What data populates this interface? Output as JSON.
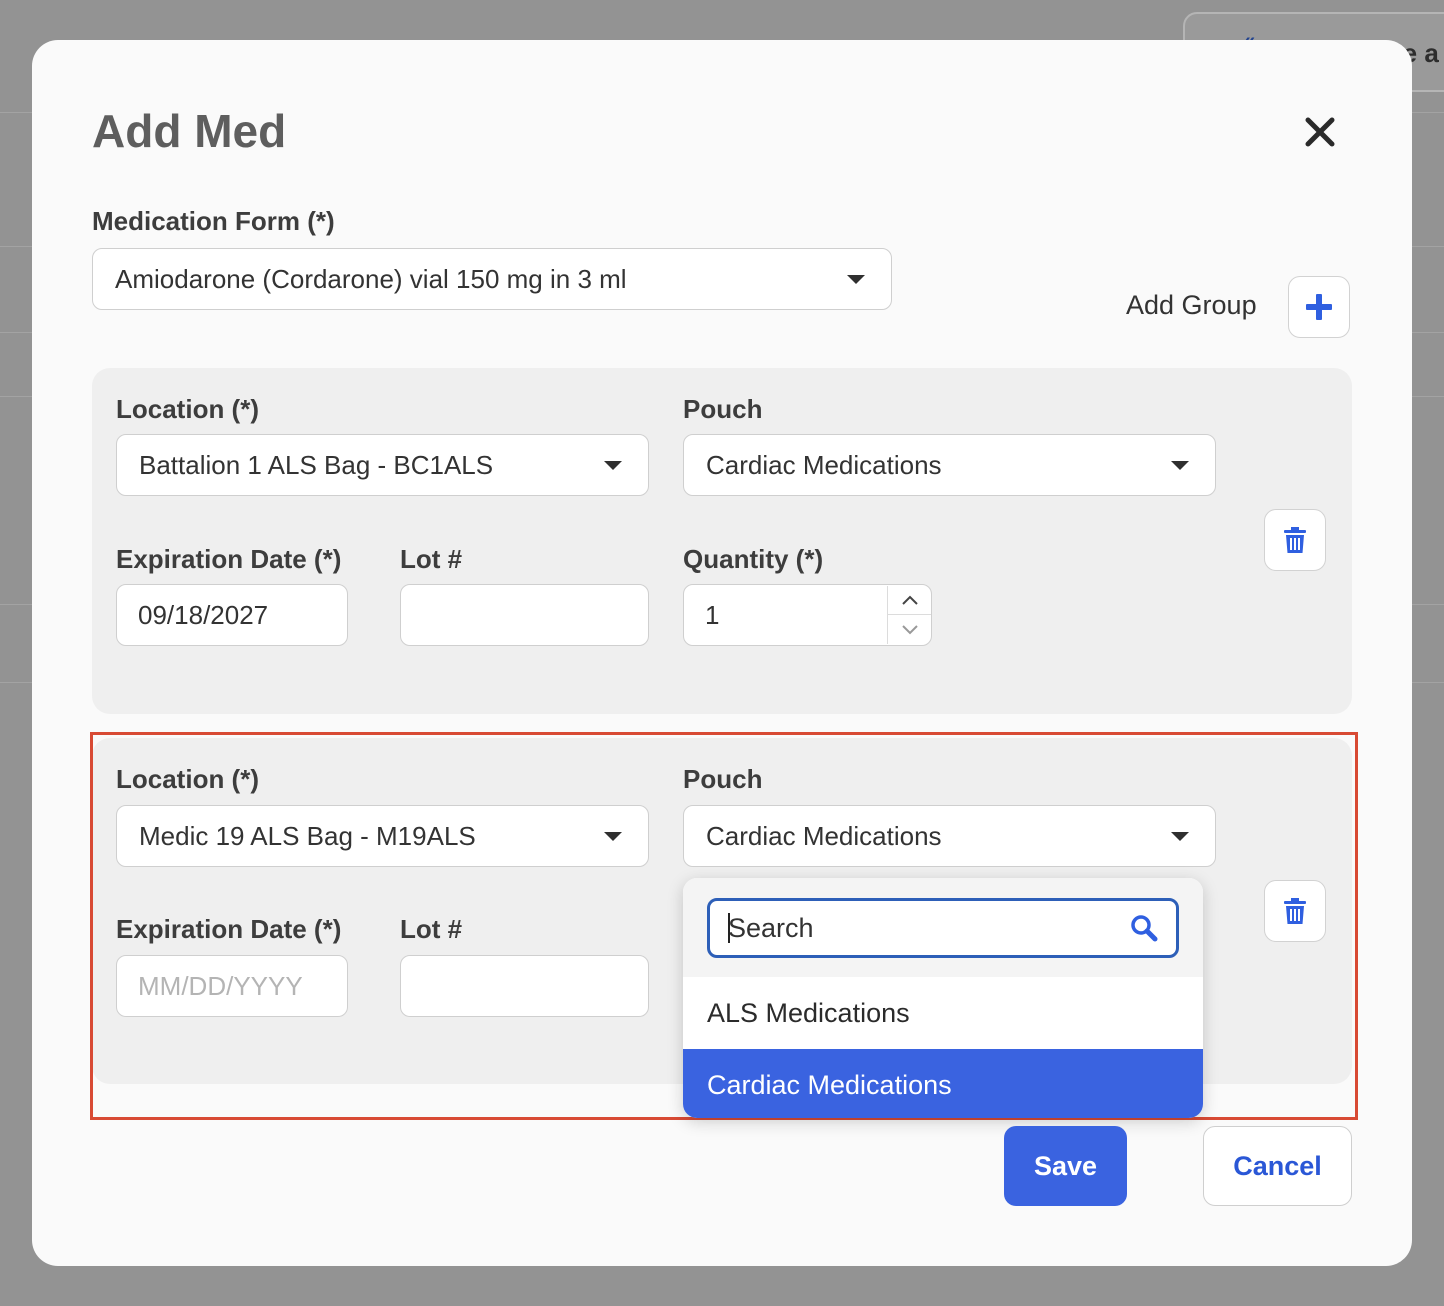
{
  "background": {
    "partial_card_text": "te a"
  },
  "modal": {
    "title": "Add Med",
    "medication_form": {
      "label": "Medication Form (*)",
      "value": "Amiodarone (Cordarone) vial 150 mg in 3 ml"
    },
    "add_group_label": "Add Group",
    "groups": [
      {
        "location_label": "Location (*)",
        "location_value": "Battalion 1 ALS Bag - BC1ALS",
        "pouch_label": "Pouch",
        "pouch_value": "Cardiac Medications",
        "expiration_label": "Expiration Date (*)",
        "expiration_value": "09/18/2027",
        "lot_label": "Lot #",
        "lot_value": "",
        "quantity_label": "Quantity (*)",
        "quantity_value": "1"
      },
      {
        "location_label": "Location (*)",
        "location_value": "Medic 19 ALS Bag - M19ALS",
        "pouch_label": "Pouch",
        "pouch_value": "Cardiac Medications",
        "expiration_label": "Expiration Date (*)",
        "expiration_placeholder": "MM/DD/YYYY",
        "lot_label": "Lot #",
        "lot_value": ""
      }
    ],
    "pouch_dropdown": {
      "search_placeholder": "Search",
      "options": [
        "ALS Medications",
        "Cardiac Medications"
      ],
      "selected": "Cardiac Medications"
    },
    "save_label": "Save",
    "cancel_label": "Cancel"
  },
  "colors": {
    "accent": "#3a63e0",
    "highlight_border": "#d84a34"
  }
}
